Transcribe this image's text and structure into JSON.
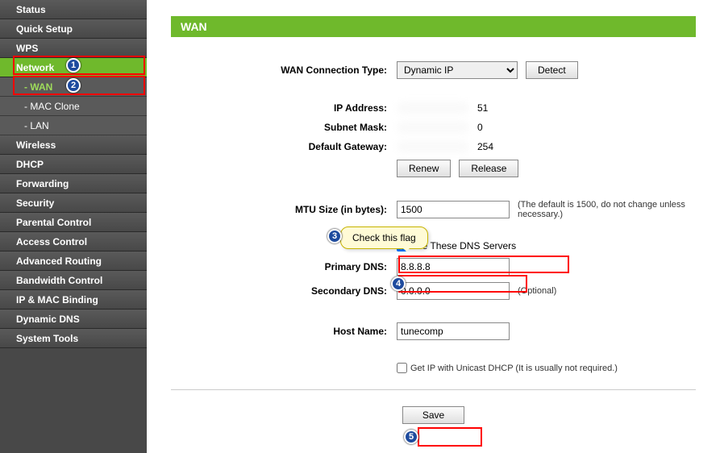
{
  "sidebar": {
    "items": [
      {
        "label": "Status"
      },
      {
        "label": "Quick Setup"
      },
      {
        "label": "WPS"
      },
      {
        "label": "Network"
      },
      {
        "label": "Wireless"
      },
      {
        "label": "DHCP"
      },
      {
        "label": "Forwarding"
      },
      {
        "label": "Security"
      },
      {
        "label": "Parental Control"
      },
      {
        "label": "Access Control"
      },
      {
        "label": "Advanced Routing"
      },
      {
        "label": "Bandwidth Control"
      },
      {
        "label": "IP & MAC Binding"
      },
      {
        "label": "Dynamic DNS"
      },
      {
        "label": "System Tools"
      }
    ],
    "subs": [
      {
        "label": "- WAN"
      },
      {
        "label": "- MAC Clone"
      },
      {
        "label": "- LAN"
      }
    ]
  },
  "page": {
    "title": "WAN"
  },
  "form": {
    "conn_type_label": "WAN Connection Type:",
    "conn_type_value": "Dynamic IP",
    "detect": "Detect",
    "ip_label": "IP Address:",
    "ip_suffix": "51",
    "mask_label": "Subnet Mask:",
    "mask_suffix": "0",
    "gw_label": "Default Gateway:",
    "gw_suffix": "254",
    "renew": "Renew",
    "release": "Release",
    "mtu_label": "MTU Size (in bytes):",
    "mtu_value": "1500",
    "mtu_hint": "(The default is 1500, do not change unless necessary.)",
    "usedns_label": "Use These DNS Servers",
    "pdns_label": "Primary DNS:",
    "pdns_value": "8.8.8.8",
    "sdns_label": "Secondary DNS:",
    "sdns_value": "0.0.0.0",
    "sdns_hint": "(Optional)",
    "host_label": "Host Name:",
    "host_value": "tunecomp",
    "unicast_label": "Get IP with Unicast DHCP (It is usually not required.)",
    "save": "Save"
  },
  "annotations": {
    "tooltip": "Check this flag"
  }
}
